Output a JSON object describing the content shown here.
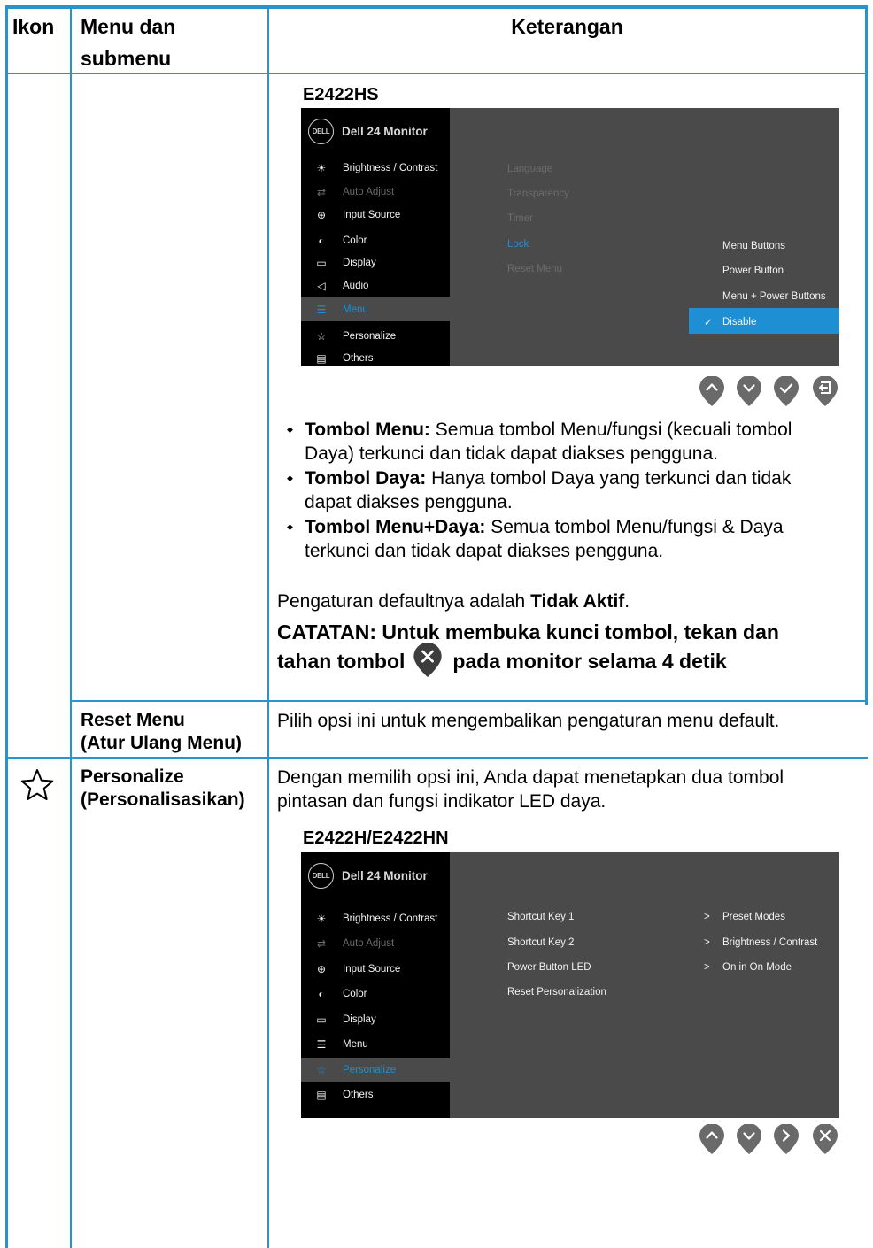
{
  "table": {
    "headers": {
      "icon": "Ikon",
      "menu_line1": "Menu dan",
      "menu_line2": "submenu",
      "desc": "Keterangan"
    }
  },
  "lock_row": {
    "model": "E2422HS",
    "osd": {
      "title": "Dell 24 Monitor",
      "logo_text": "DELL",
      "menu": [
        {
          "label": "Brightness / Contrast",
          "icon": "brightness-icon",
          "glyph": "☀"
        },
        {
          "label": "Auto Adjust",
          "icon": "auto-adjust-icon",
          "glyph": "⇄"
        },
        {
          "label": "Input Source",
          "icon": "input-source-icon",
          "glyph": "⊕"
        },
        {
          "label": "Color",
          "icon": "color-icon",
          "glyph": "◐"
        },
        {
          "label": "Display",
          "icon": "display-icon",
          "glyph": "▭"
        },
        {
          "label": "Audio",
          "icon": "audio-icon",
          "glyph": "◁"
        },
        {
          "label": "Menu",
          "icon": "menu-icon",
          "glyph": "☰"
        },
        {
          "label": "Personalize",
          "icon": "star-icon",
          "glyph": "☆"
        },
        {
          "label": "Others",
          "icon": "others-icon",
          "glyph": "▤"
        }
      ],
      "submenu": [
        "Language",
        "Transparency",
        "Timer",
        "Lock",
        "Reset Menu"
      ],
      "options": [
        "Menu Buttons",
        "Power Button",
        "Menu + Power Buttons",
        "Disable"
      ],
      "selected_option_mark": "✓"
    },
    "bullets": [
      {
        "bold": "Tombol Menu:",
        "line1": " Semua tombol Menu/fungsi (kecuali tombol",
        "line2": "Daya) terkunci dan tidak dapat diakses pengguna."
      },
      {
        "bold": "Tombol Daya:",
        "line1": " Hanya tombol Daya yang terkunci dan tidak",
        "line2": "dapat diakses pengguna."
      },
      {
        "bold": "Tombol Menu+Daya:",
        "line1": " Semua tombol Menu/fungsi & Daya",
        "line2": "terkunci dan tidak dapat diakses pengguna."
      }
    ],
    "default_text": "Pengaturan defaultnya adalah ",
    "default_value": "Tidak Aktif",
    "default_end": ".",
    "note_line1": "CATATAN: Untuk membuka kunci tombol, tekan dan",
    "note_line2a": "tahan tombol",
    "note_line2b": "pada monitor selama 4 detik"
  },
  "reset_row": {
    "name_line1": "Reset Menu",
    "name_line2": "(Atur Ulang Menu)",
    "desc": "Pilih opsi ini untuk mengembalikan pengaturan menu default."
  },
  "personalize_row": {
    "icon": "star-icon",
    "name_line1": "Personalize",
    "name_line2": "(Personalisasikan)",
    "desc_line1": "Dengan memilih opsi ini, Anda dapat menetapkan dua tombol",
    "desc_line2": "pintasan dan fungsi indikator LED daya.",
    "model": "E2422H/E2422HN",
    "osd": {
      "title": "Dell 24 Monitor",
      "logo_text": "DELL",
      "menu": [
        {
          "label": "Brightness / Contrast",
          "icon": "brightness-icon",
          "glyph": "☀"
        },
        {
          "label": "Auto Adjust",
          "icon": "auto-adjust-icon",
          "glyph": "⇄"
        },
        {
          "label": "Input Source",
          "icon": "input-source-icon",
          "glyph": "⊕"
        },
        {
          "label": "Color",
          "icon": "color-icon",
          "glyph": "◐"
        },
        {
          "label": "Display",
          "icon": "display-icon",
          "glyph": "▭"
        },
        {
          "label": "Menu",
          "icon": "menu-icon",
          "glyph": "☰"
        },
        {
          "label": "Personalize",
          "icon": "star-icon",
          "glyph": "☆"
        },
        {
          "label": "Others",
          "icon": "others-icon",
          "glyph": "▤"
        }
      ],
      "submenu": [
        "Shortcut Key 1",
        "Shortcut Key 2",
        "Power Button LED",
        "Reset Personalization"
      ],
      "values": [
        "Preset Modes",
        "Brightness / Contrast",
        "On in On Mode"
      ],
      "value_marker": ">"
    }
  },
  "colors": {
    "table_line": "#2a93cc",
    "osd_bg": "#4a4a4a",
    "osd_accent": "#1e8fd3"
  }
}
